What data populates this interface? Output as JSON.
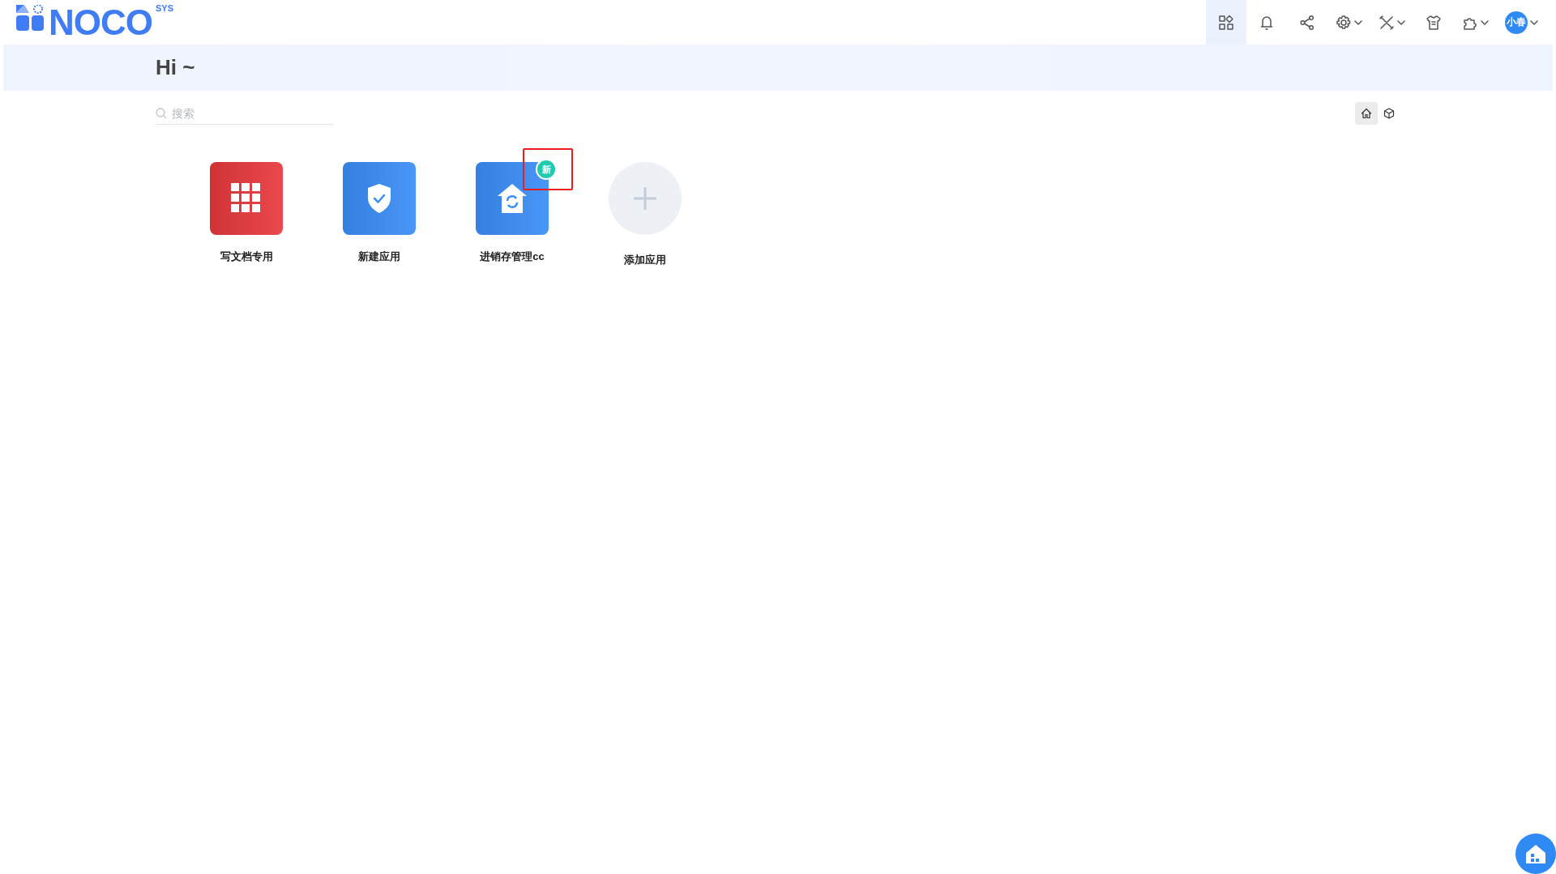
{
  "logo": {
    "text": "NOCO",
    "sup": "SYS"
  },
  "toolbar": [
    {
      "kind": "apps",
      "selected": true,
      "dropdown": false
    },
    {
      "kind": "bell",
      "selected": false,
      "dropdown": false
    },
    {
      "kind": "share",
      "selected": false,
      "dropdown": false
    },
    {
      "kind": "gear",
      "selected": false,
      "dropdown": true
    },
    {
      "kind": "tools",
      "selected": false,
      "dropdown": true
    },
    {
      "kind": "shirt",
      "selected": false,
      "dropdown": false
    },
    {
      "kind": "puzzle",
      "selected": false,
      "dropdown": true
    }
  ],
  "user": {
    "avatar": "小春"
  },
  "greeting": "Hi ~",
  "search": {
    "placeholder": "搜索"
  },
  "view_toggle": [
    {
      "kind": "home",
      "selected": true
    },
    {
      "kind": "cube",
      "selected": false
    }
  ],
  "apps": [
    {
      "name": "写文档专用",
      "kind": "grid",
      "color": "#e8393d",
      "highlighted": false
    },
    {
      "name": "新建应用",
      "kind": "shield",
      "color": "#3a8ef8",
      "highlighted": false
    },
    {
      "name": "进销存管理cc",
      "kind": "house",
      "color": "#3a8ef8",
      "badge": "新",
      "highlighted": true
    }
  ],
  "add_app": {
    "label": "添加应用"
  }
}
